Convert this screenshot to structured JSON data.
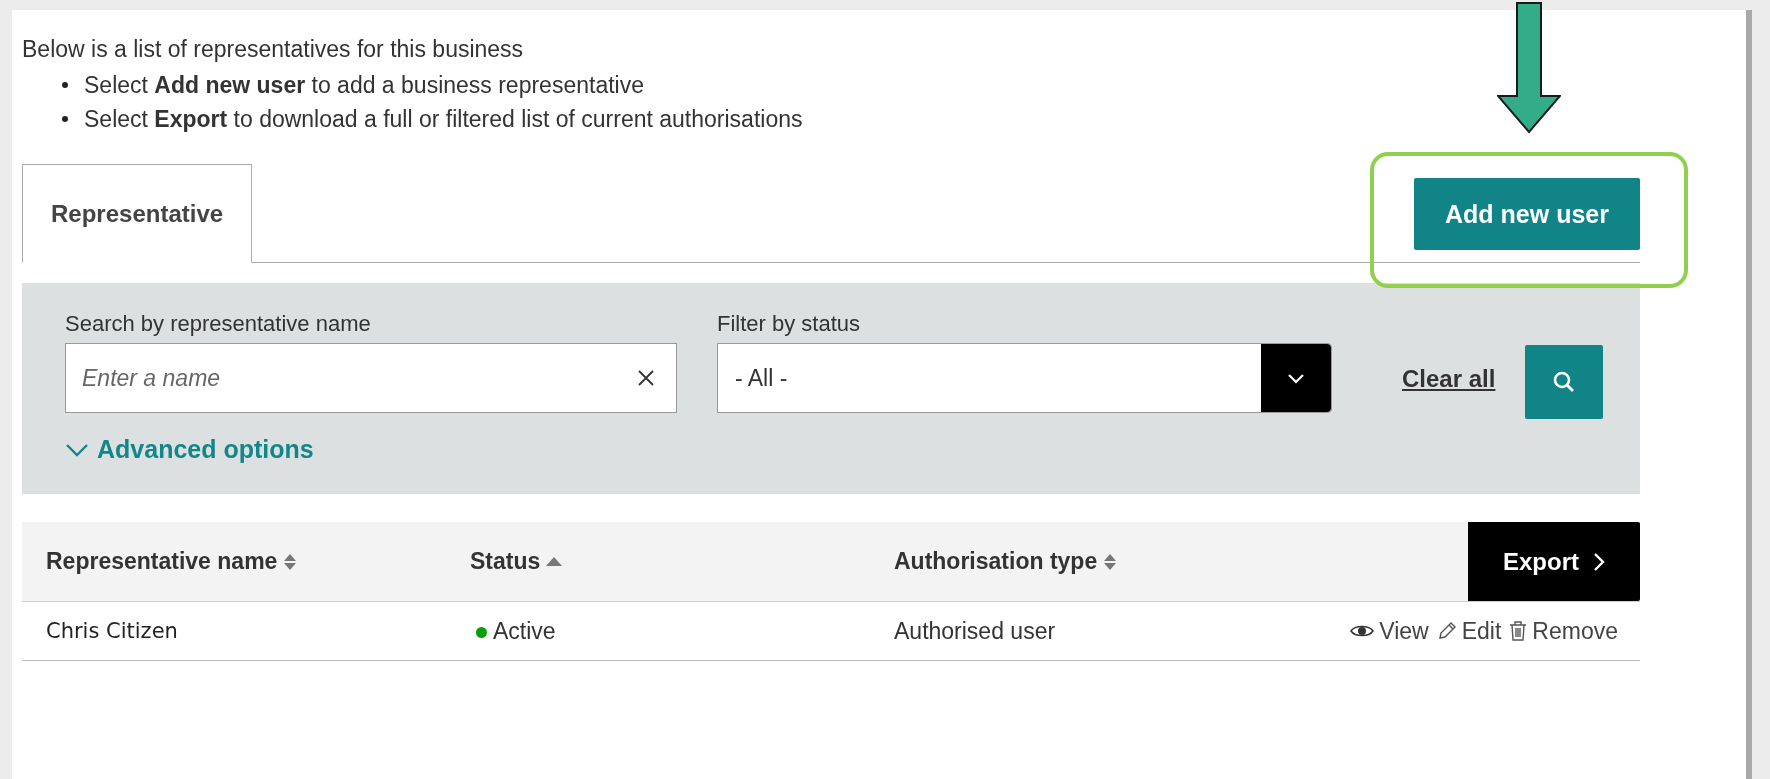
{
  "intro": {
    "text": "Below is a list of representatives for this business",
    "bullets": [
      "Select **Add new user** to add a business representative",
      "Select **Export** to download a full or filtered list of current authorisations"
    ]
  },
  "tabs": [
    {
      "label": "Representative",
      "selected": true
    }
  ],
  "add_button": "Add new user",
  "filters": {
    "search": {
      "label": "Search by representative name",
      "placeholder": "Enter a name"
    },
    "status": {
      "label": "Filter by status",
      "value": "- All -"
    },
    "clear": "Clear all",
    "advanced": {
      "label": "Advanced options",
      "expanded": false
    }
  },
  "table": {
    "columns": [
      {
        "label": "Representative name",
        "sorted": false
      },
      {
        "label": "Status",
        "sorted": true
      },
      {
        "label": "Authorisation type",
        "sorted": false
      }
    ],
    "export": "Export",
    "rows": [
      {
        "name": "Chris Citizen",
        "status": {
          "label": "Active",
          "color": "#0a9e0a"
        },
        "type": "Authorised user",
        "actions": [
          {
            "kind": "view",
            "label": "View"
          },
          {
            "kind": "edit",
            "label": "Edit"
          },
          {
            "kind": "remove",
            "label": "Remove"
          }
        ]
      }
    ]
  }
}
